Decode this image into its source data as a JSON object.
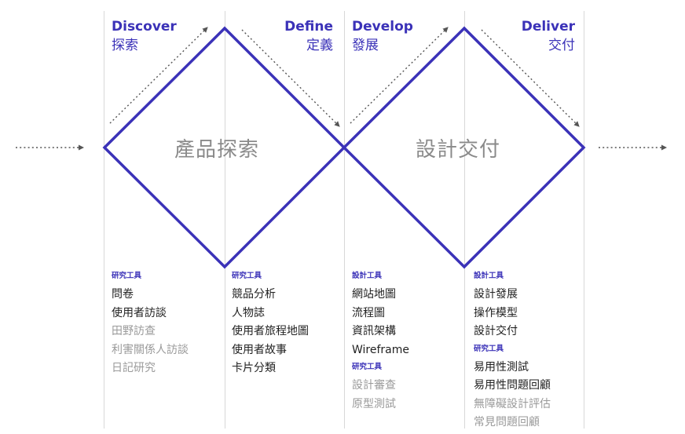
{
  "phases": [
    {
      "en": "Discover",
      "zh": "探索"
    },
    {
      "en": "Define",
      "zh": "定義"
    },
    {
      "en": "Develop",
      "zh": "發展"
    },
    {
      "en": "Deliver",
      "zh": "交付"
    }
  ],
  "diamonds": [
    {
      "label": "產品探索"
    },
    {
      "label": "設計交付"
    }
  ],
  "columns": [
    {
      "groups": [
        {
          "heading": "研究工具",
          "items": [
            {
              "text": "問卷",
              "tone": "dark"
            },
            {
              "text": "使用者訪談",
              "tone": "dark"
            },
            {
              "text": "田野訪查",
              "tone": "gray"
            },
            {
              "text": "利害關係人訪談",
              "tone": "gray"
            },
            {
              "text": "日記研究",
              "tone": "gray"
            }
          ]
        }
      ]
    },
    {
      "groups": [
        {
          "heading": "研究工具",
          "items": [
            {
              "text": "競品分析",
              "tone": "dark"
            },
            {
              "text": "人物誌",
              "tone": "dark"
            },
            {
              "text": "使用者旅程地圖",
              "tone": "dark"
            },
            {
              "text": "使用者故事",
              "tone": "dark"
            },
            {
              "text": "卡片分類",
              "tone": "dark"
            }
          ]
        }
      ]
    },
    {
      "groups": [
        {
          "heading": "設計工具",
          "items": [
            {
              "text": "網站地圖",
              "tone": "dark"
            },
            {
              "text": "流程圖",
              "tone": "dark"
            },
            {
              "text": "資訊架構",
              "tone": "dark"
            },
            {
              "text": "Wireframe",
              "tone": "dark"
            }
          ]
        },
        {
          "heading": "研究工具",
          "items": [
            {
              "text": "設計審查",
              "tone": "gray"
            },
            {
              "text": "原型測試",
              "tone": "gray"
            }
          ]
        }
      ]
    },
    {
      "groups": [
        {
          "heading": "設計工具",
          "items": [
            {
              "text": "設計發展",
              "tone": "dark"
            },
            {
              "text": "操作模型",
              "tone": "dark"
            },
            {
              "text": "設計交付",
              "tone": "dark"
            }
          ]
        },
        {
          "heading": "研究工具",
          "items": [
            {
              "text": "易用性測試",
              "tone": "dark"
            },
            {
              "text": "易用性問題回顧",
              "tone": "dark"
            },
            {
              "text": "無障礙設計評估",
              "tone": "gray"
            },
            {
              "text": "常見問題回顧",
              "tone": "gray"
            }
          ]
        }
      ]
    }
  ],
  "colors": {
    "accent": "#3b32b8",
    "gray_text": "#9a9a9a",
    "guide_line": "#d8d8d8",
    "arrow": "#555555"
  }
}
